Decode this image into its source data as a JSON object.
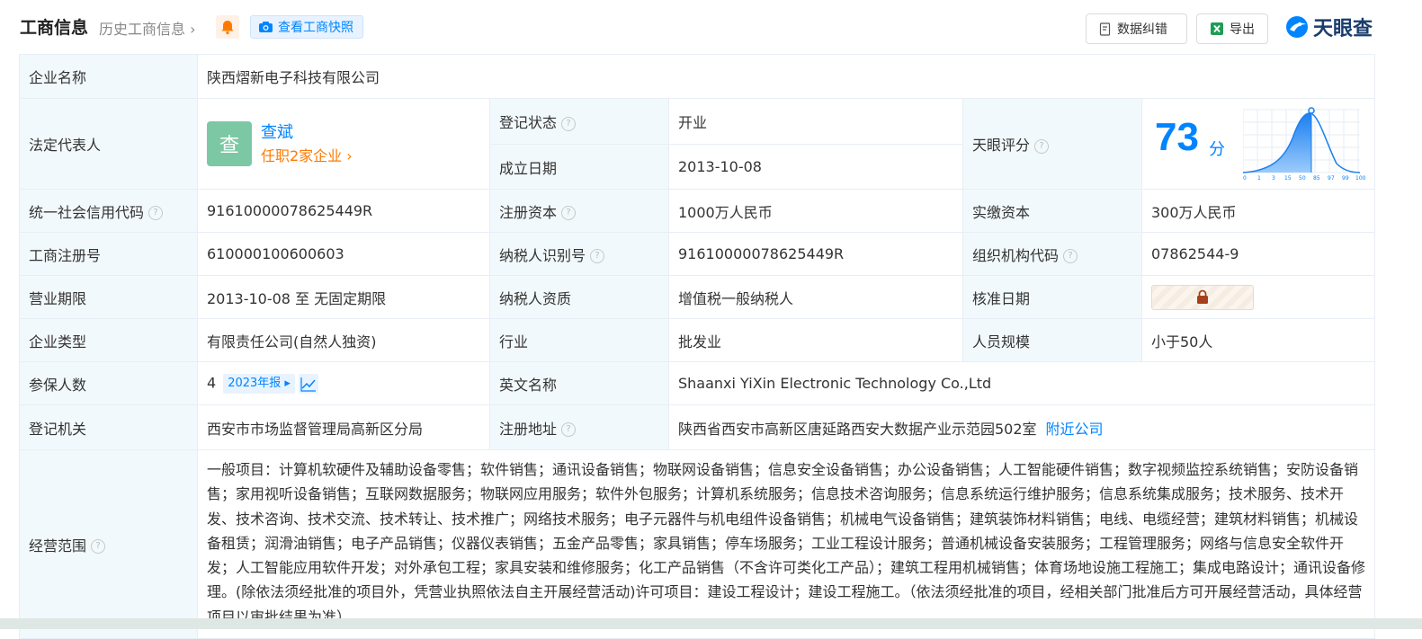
{
  "header": {
    "title": "工商信息",
    "history_label": "历史工商信息",
    "snapshot_label": "查看工商快照",
    "data_correction_label": "数据纠错",
    "export_label": "导出",
    "logo_text": "天眼查"
  },
  "company": {
    "name_key": "企业名称",
    "name_value": "陕西熠新电子科技有限公司",
    "legal_rep_key": "法定代表人",
    "legal_rep_avatar": "查",
    "legal_rep_name": "查斌",
    "legal_rep_jobs": "任职2家企业",
    "reg_status_key": "登记状态",
    "reg_status_value": "开业",
    "found_date_key": "成立日期",
    "found_date_value": "2013-10-08",
    "score_key": "天眼评分",
    "score_value": "73",
    "score_unit": "分",
    "score_axis": [
      "0",
      "1",
      "3",
      "15",
      "50",
      "85",
      "97",
      "99",
      "100"
    ],
    "credit_code_key": "统一社会信用代码",
    "credit_code_value": "91610000078625449R",
    "reg_capital_key": "注册资本",
    "reg_capital_value": "1000万人民币",
    "paid_capital_key": "实缴资本",
    "paid_capital_value": "300万人民币",
    "reg_no_key": "工商注册号",
    "reg_no_value": "610000100600603",
    "taxpayer_id_key": "纳税人识别号",
    "taxpayer_id_value": "91610000078625449R",
    "org_code_key": "组织机构代码",
    "org_code_value": "07862544-9",
    "biz_term_key": "营业期限",
    "biz_term_value": "2013-10-08 至 无固定期限",
    "taxpayer_qual_key": "纳税人资质",
    "taxpayer_qual_value": "增值税一般纳税人",
    "approve_date_key": "核准日期",
    "type_key": "企业类型",
    "type_value": "有限责任公司(自然人独资)",
    "industry_key": "行业",
    "industry_value": "批发业",
    "staff_key": "人员规模",
    "staff_value": "小于50人",
    "insured_key": "参保人数",
    "insured_value": "4",
    "insured_year": "2023年报",
    "en_name_key": "英文名称",
    "en_name_value": "Shaanxi YiXin Electronic Technology Co.,Ltd",
    "authority_key": "登记机关",
    "authority_value": "西安市市场监督管理局高新区分局",
    "address_key": "注册地址",
    "address_value": "陕西省西安市高新区唐延路西安大数据产业示范园502室",
    "nearby_label": "附近公司",
    "scope_key": "经营范围",
    "scope_value": "一般项目：计算机软硬件及辅助设备零售；软件销售；通讯设备销售；物联网设备销售；信息安全设备销售；办公设备销售；人工智能硬件销售；数字视频监控系统销售；安防设备销售；家用视听设备销售；互联网数据服务；物联网应用服务；软件外包服务；计算机系统服务；信息技术咨询服务；信息系统运行维护服务；信息系统集成服务；技术服务、技术开发、技术咨询、技术交流、技术转让、技术推广；网络技术服务；电子元器件与机电组件设备销售；机械电气设备销售；建筑装饰材料销售；电线、电缆经营；建筑材料销售；机械设备租赁；润滑油销售；电子产品销售；仪器仪表销售；五金产品零售；家具销售；停车场服务；工业工程设计服务；普通机械设备安装服务；工程管理服务；网络与信息安全软件开发；人工智能应用软件开发；对外承包工程；家具安装和维修服务；化工产品销售（不含许可类化工产品）；建筑工程用机械销售；体育场地设施工程施工；集成电路设计；通讯设备修理。(除依法须经批准的项目外，凭营业执照依法自主开展经营活动)许可项目：建设工程设计；建设工程施工。（依法须经批准的项目，经相关部门批准后方可开展经营活动，具体经营项目以审批结果为准）"
  }
}
